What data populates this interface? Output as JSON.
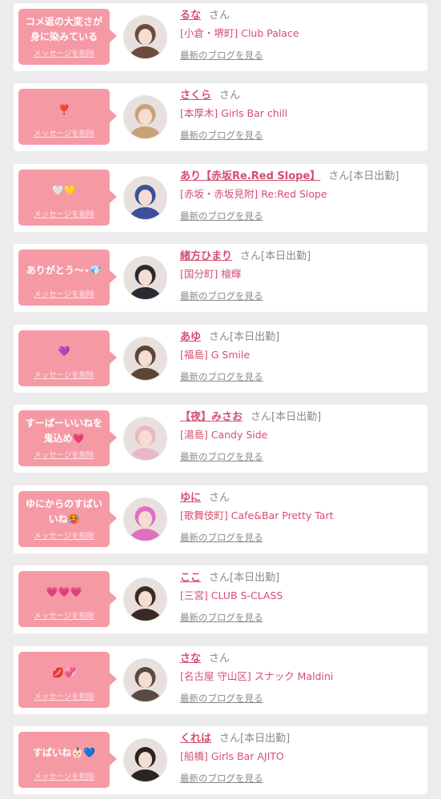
{
  "list": {
    "delete_label": "メッセージを削除",
    "honorific": "さん",
    "blog_link": "最新のブログを見る",
    "items": [
      {
        "message": "コメ返の大変さが\n身に染みている",
        "name": "るな",
        "duty": "",
        "shop": "[小倉・堺町] Club Palace",
        "avatar_color": "#6b4b3e"
      },
      {
        "message": "❣️",
        "name": "さくら",
        "duty": "",
        "shop": "[本厚木] Girls Bar chill",
        "avatar_color": "#c9a27a"
      },
      {
        "message": "🤍💛",
        "name": "あり【赤坂Re.Red Slope】",
        "duty": "[本日出勤]",
        "shop": "[赤坂・赤坂見附] Re:Red Slope",
        "avatar_color": "#3b4f9a"
      },
      {
        "message": "ありがとう〜⋆💎",
        "name": "緒方ひまり",
        "duty": "[本日出勤]",
        "shop": "[国分町] 檜輝",
        "avatar_color": "#2a2a33"
      },
      {
        "message": "💜",
        "name": "あゆ",
        "duty": "[本日出勤]",
        "shop": "[福島] G Smile",
        "avatar_color": "#5b4636"
      },
      {
        "message": "すーぱーいいねを\n鬼込め💗",
        "name": "【夜】みさお",
        "duty": "[本日出勤]",
        "shop": "[湯島] Candy Side",
        "avatar_color": "#e9b7c7"
      },
      {
        "message": "ゆにからのすばい\nいね🥵",
        "name": "ゆに",
        "duty": "",
        "shop": "[歌舞伎町] Cafe&Bar Pretty Tart",
        "avatar_color": "#e070c0"
      },
      {
        "message": "💗💗💗",
        "name": "ここ",
        "duty": "[本日出勤]",
        "shop": "[三宮] CLUB S-CLASS",
        "avatar_color": "#3a2a24"
      },
      {
        "message": "💋💞",
        "name": "さな",
        "duty": "",
        "shop": "[名古屋 守山区] スナック Maldini",
        "avatar_color": "#5a4a44"
      },
      {
        "message": "すばいね👶🏻💙",
        "name": "くれは",
        "duty": "[本日出勤]",
        "shop": "[船橋] Girls Bar AJITO",
        "avatar_color": "#2b2420"
      }
    ]
  }
}
